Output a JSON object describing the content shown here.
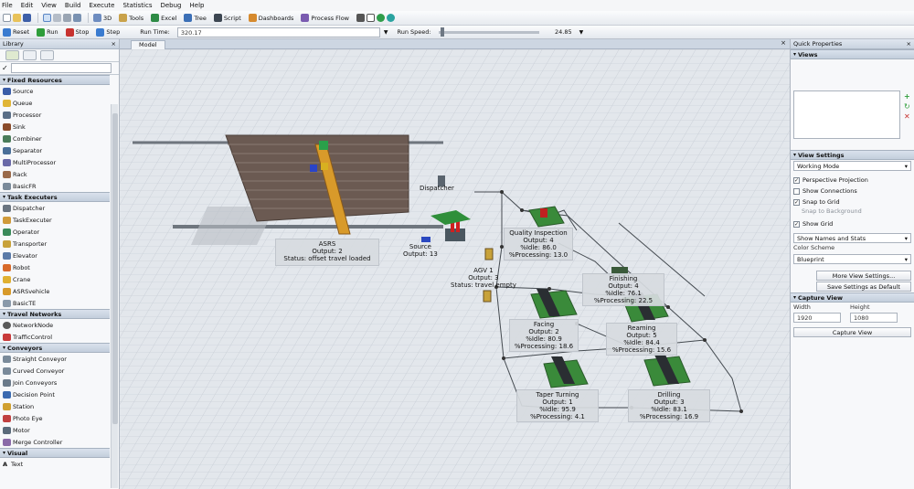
{
  "menu": [
    "File",
    "Edit",
    "View",
    "Build",
    "Execute",
    "Statistics",
    "Debug",
    "Help"
  ],
  "toolbar": {
    "three_d": "3D",
    "tools": "Tools",
    "excel": "Excel",
    "tree": "Tree",
    "script": "Script",
    "dashboards": "Dashboards",
    "process_flow": "Process Flow"
  },
  "run_controls": {
    "reset": "Reset",
    "run": "Run",
    "stop": "Stop",
    "step": "Step",
    "run_time_label": "Run Time:",
    "run_time_value": "320.17",
    "run_speed_label": "Run Speed:",
    "run_speed_value": "24.85",
    "run_speed_fraction": 0.02
  },
  "library": {
    "title": "Library",
    "categories": [
      {
        "name": "Fixed Resources",
        "items": [
          "Source",
          "Queue",
          "Processor",
          "Sink",
          "Combiner",
          "Separator",
          "MultiProcessor",
          "Rack",
          "BasicFR"
        ]
      },
      {
        "name": "Task Executers",
        "items": [
          "Dispatcher",
          "TaskExecuter",
          "Operator",
          "Transporter",
          "Elevator",
          "Robot",
          "Crane",
          "ASRSvehicle",
          "BasicTE"
        ]
      },
      {
        "name": "Travel Networks",
        "items": [
          "NetworkNode",
          "TrafficControl"
        ]
      },
      {
        "name": "Conveyors",
        "items": [
          "Straight Conveyor",
          "Curved Conveyor",
          "Join Conveyors",
          "Decision Point",
          "Station",
          "Photo Eye",
          "Motor",
          "Merge Controller"
        ]
      },
      {
        "name": "Visual",
        "items": [
          "Text"
        ]
      }
    ]
  },
  "viewport": {
    "tab": "Model"
  },
  "model": {
    "asrs": {
      "name": "ASRS",
      "output": "Output: 2",
      "status": "Status: offset travel loaded"
    },
    "dispatcher": {
      "name": "Dispatcher"
    },
    "source": {
      "name": "Source",
      "output": "Output: 13"
    },
    "agv": {
      "name": "AGV 1",
      "output": "Output: 3",
      "status": "Status: travel empty"
    },
    "quality": {
      "name": "Quality Inspection",
      "output": "Output: 4",
      "idle": "%Idle: 86.0",
      "processing": "%Processing: 13.0"
    },
    "finishing": {
      "name": "Finishing",
      "output": "Output: 4",
      "idle": "%Idle: 76.1",
      "processing": "%Processing: 22.5"
    },
    "facing": {
      "name": "Facing",
      "output": "Output: 2",
      "idle": "%Idle: 80.9",
      "processing": "%Processing: 18.6"
    },
    "reaming": {
      "name": "Reaming",
      "output": "Output: 5",
      "idle": "%Idle: 84.4",
      "processing": "%Processing: 15.6"
    },
    "taper": {
      "name": "Taper Turning",
      "output": "Output: 1",
      "idle": "%Idle: 95.9",
      "processing": "%Processing: 4.1"
    },
    "drilling": {
      "name": "Drilling",
      "output": "Output: 3",
      "idle": "%Idle: 83.1",
      "processing": "%Processing: 16.9"
    }
  },
  "quick": {
    "title": "Quick Properties",
    "views": "Views",
    "view_settings": "View Settings",
    "working_mode": "Working Mode",
    "checks": [
      {
        "label": "Perspective Projection",
        "checked": true
      },
      {
        "label": "Show Connections",
        "checked": false
      },
      {
        "label": "Snap to Grid",
        "checked": true
      }
    ],
    "snap_background": "Snap to Background",
    "show_grid": "Show Grid",
    "show_names": "Show Names and Stats",
    "color_scheme_label": "Color Scheme",
    "color_scheme": "Blueprint",
    "more_view": "More View Settings...",
    "save_default": "Save Settings as Default",
    "capture_view": "Capture View",
    "width_label": "Width",
    "height_label": "Height",
    "width": "1920",
    "height": "1080",
    "capture_button": "Capture View"
  }
}
